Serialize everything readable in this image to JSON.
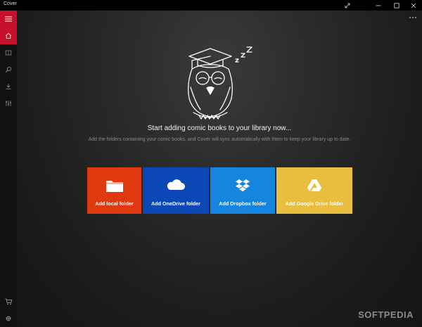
{
  "window": {
    "title": "Cover"
  },
  "rail": {
    "items": [
      {
        "name": "home",
        "icon": "home-icon",
        "active": true
      },
      {
        "name": "library",
        "icon": "book-icon"
      },
      {
        "name": "search",
        "icon": "search-icon"
      },
      {
        "name": "downloads",
        "icon": "download-icon"
      },
      {
        "name": "filters",
        "icon": "sliders-icon"
      },
      {
        "name": "store",
        "icon": "cart-icon"
      },
      {
        "name": "settings",
        "icon": "gear-icon"
      }
    ]
  },
  "empty_state": {
    "headline": "Start adding comic books to your library now...",
    "subline": "Add the folders containing your comic books, and Cover will sync automatically with them to keep your library up to date."
  },
  "tiles": [
    {
      "label": "Add local folder",
      "color": "#e0380f",
      "icon": "folder-icon"
    },
    {
      "label": "Add OneDrive folder",
      "color": "#0b47b6",
      "icon": "cloud-icon"
    },
    {
      "label": "Add Dropbox folder",
      "color": "#1585e0",
      "icon": "dropbox-icon"
    },
    {
      "label": "Add Google Drive folder",
      "color": "#e8be3e",
      "icon": "google-drive-icon"
    }
  ],
  "colors": {
    "accent": "#c8102e",
    "rail": "#111111"
  },
  "watermark": "SOFTPEDIA"
}
